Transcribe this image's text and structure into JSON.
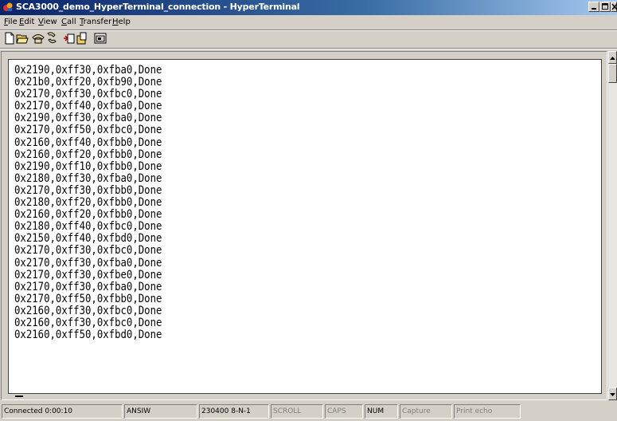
{
  "window": {
    "title": "SCA3000_demo_HyperTerminal_connection - HyperTerminal",
    "app_icon": "hyperterminal-icon",
    "controls": [
      "minimize-icon",
      "maximize-icon",
      "close-icon"
    ]
  },
  "menu": {
    "items": [
      {
        "accel": "F",
        "rest": "ile"
      },
      {
        "accel": "E",
        "rest": "dit"
      },
      {
        "accel": "V",
        "rest": "iew"
      },
      {
        "accel": "C",
        "rest": "all"
      },
      {
        "accel": "T",
        "rest": "ransfer"
      },
      {
        "accel": "H",
        "rest": "elp"
      }
    ]
  },
  "toolbar": {
    "buttons": [
      "new-connection-icon",
      "open-icon",
      "connect-icon",
      "disconnect-icon",
      "send-icon",
      "receive-icon",
      "properties-icon"
    ]
  },
  "terminal": {
    "lines": [
      "0x2190,0xff30,0xfba0,Done",
      "0x21b0,0xff20,0xfb90,Done",
      "0x2170,0xff30,0xfbc0,Done",
      "0x2170,0xff40,0xfba0,Done",
      "0x2190,0xff30,0xfba0,Done",
      "0x2170,0xff50,0xfbc0,Done",
      "0x2160,0xff40,0xfbb0,Done",
      "0x2160,0xff20,0xfbb0,Done",
      "0x2190,0xff10,0xfbb0,Done",
      "0x2180,0xff30,0xfba0,Done",
      "0x2170,0xff30,0xfbb0,Done",
      "0x2180,0xff20,0xfbb0,Done",
      "0x2160,0xff20,0xfbb0,Done",
      "0x2180,0xff40,0xfbc0,Done",
      "0x2150,0xff40,0xfbd0,Done",
      "0x2170,0xff30,0xfbc0,Done",
      "0x2170,0xff30,0xfba0,Done",
      "0x2170,0xff30,0xfbe0,Done",
      "0x2170,0xff30,0xfba0,Done",
      "0x2170,0xff50,0xfbb0,Done",
      "0x2160,0xff30,0xfbc0,Done",
      "0x2160,0xff30,0xfbc0,Done",
      "0x2160,0xff50,0xfbd0,Done"
    ]
  },
  "status": {
    "connected": "Connected 0:00:10",
    "emulation": "ANSIW",
    "port_settings": "230400 8-N-1",
    "scroll": "SCROLL",
    "caps": "CAPS",
    "num": "NUM",
    "capture": "Capture",
    "print_echo": "Print echo"
  },
  "colors": {
    "titlebar_start": "#0a246a",
    "titlebar_end": "#a6caf0",
    "chrome": "#d4d0c8",
    "terminal_bg": "#ffffff",
    "terminal_fg": "#000000"
  }
}
